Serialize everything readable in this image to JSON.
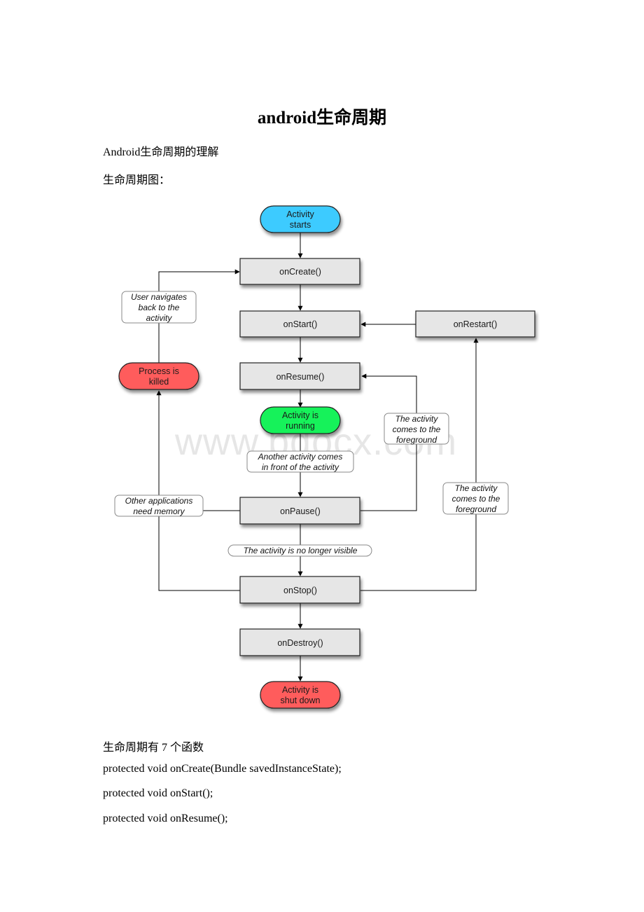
{
  "document": {
    "title": "android生命周期",
    "subtitle": "Android生命周期的理解",
    "diagram_caption": "生命周期图：",
    "functions_intro": "生命周期有 7 个函数",
    "code_lines": [
      "protected void onCreate(Bundle savedInstanceState);",
      "protected void onStart();",
      "protected void onResume();"
    ],
    "watermark": "www.bdocx.com"
  },
  "diagram": {
    "colors": {
      "start": "#3ecbff",
      "running": "#16f25a",
      "terminal": "#ff5c5c",
      "method": "#e6e6e6",
      "line": "#000000"
    },
    "nodes": {
      "activity_starts": [
        "Activity",
        "starts"
      ],
      "on_create": "onCreate()",
      "on_start": "onStart()",
      "on_restart": "onRestart()",
      "on_resume": "onResume()",
      "process_killed": [
        "Process is",
        "killed"
      ],
      "activity_running": [
        "Activity is",
        "running"
      ],
      "on_pause": "onPause()",
      "on_stop": "onStop()",
      "on_destroy": "onDestroy()",
      "activity_shut_down": [
        "Activity is",
        "shut down"
      ]
    },
    "labels": {
      "user_navigates_back": [
        "User navigates",
        "back to the",
        "activity"
      ],
      "another_activity_front": [
        "Another activity comes",
        "in front of the activity"
      ],
      "foreground_resume": [
        "The activity",
        "comes to the",
        "foreground"
      ],
      "foreground_restart": [
        "The activity",
        "comes to the",
        "foreground"
      ],
      "other_apps_memory": [
        "Other applications",
        "need memory"
      ],
      "no_longer_visible": "The activity is no longer visible"
    }
  }
}
